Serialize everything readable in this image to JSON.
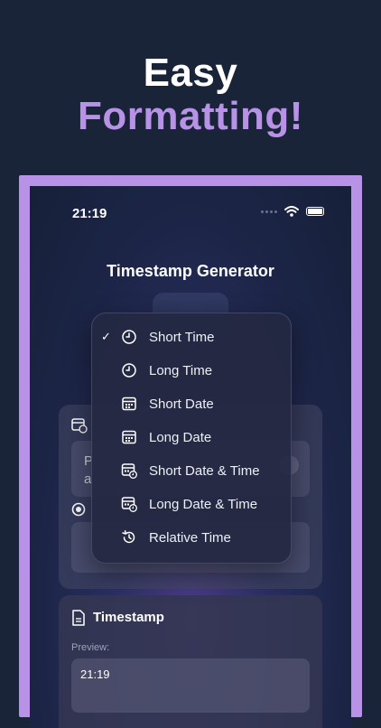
{
  "headline": {
    "line1": "Easy",
    "line2": "Formatting!"
  },
  "status": {
    "time": "21:19"
  },
  "app": {
    "title": "Timestamp Generator"
  },
  "input_card": {
    "partial_line1": "P",
    "partial_line2": "a"
  },
  "timestamp_card": {
    "title": "Timestamp",
    "preview_label": "Preview:",
    "preview_value": "21:19"
  },
  "menu": {
    "selected": "Short Time",
    "items": [
      {
        "label": "Short Time",
        "icon": "clock-icon",
        "checked": true
      },
      {
        "label": "Long Time",
        "icon": "clock-icon",
        "checked": false
      },
      {
        "label": "Short Date",
        "icon": "calendar-icon",
        "checked": false
      },
      {
        "label": "Long Date",
        "icon": "calendar-icon",
        "checked": false
      },
      {
        "label": "Short Date & Time",
        "icon": "calendar-clock-icon",
        "checked": false
      },
      {
        "label": "Long Date & Time",
        "icon": "calendar-clock-icon",
        "checked": false
      },
      {
        "label": "Relative Time",
        "icon": "history-icon",
        "checked": false
      }
    ]
  },
  "colors": {
    "background": "#1a2438",
    "accent": "#b792e6",
    "text": "#ffffff"
  }
}
